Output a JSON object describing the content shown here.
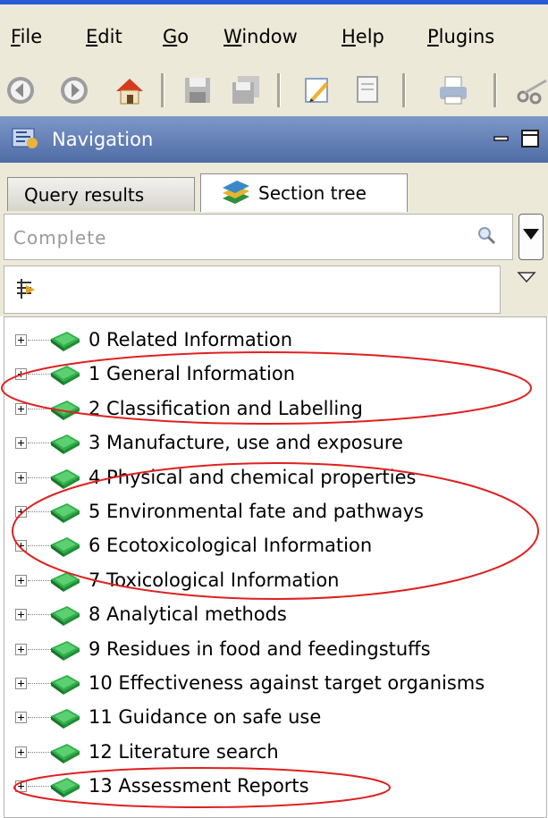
{
  "menu": {
    "items": [
      {
        "u": "F",
        "rest": "ile"
      },
      {
        "u": "E",
        "rest": "dit"
      },
      {
        "u": "G",
        "rest": "o"
      },
      {
        "u": "W",
        "rest": "indow"
      },
      {
        "u": "H",
        "rest": "elp"
      },
      {
        "u": "P",
        "rest": "lugins"
      }
    ]
  },
  "toolbar": {
    "icons": [
      "back-icon",
      "forward-icon",
      "home-icon",
      "save-icon",
      "save-all-icon",
      "edit-icon",
      "document-icon",
      "print-icon",
      "cut-icon"
    ]
  },
  "navigation": {
    "title": "Navigation"
  },
  "tabs": {
    "query_results": "Query results",
    "section_tree": "Section tree"
  },
  "search": {
    "value": "Complete"
  },
  "tree": {
    "items": [
      "0 Related Information",
      "1 General Information",
      "2 Classification and Labelling",
      "3 Manufacture, use and exposure",
      "4 Physical and chemical properties",
      "5 Environmental fate and pathways",
      "6 Ecotoxicological Information",
      "7 Toxicological Information",
      "8 Analytical methods",
      "9 Residues in food and feedingstuffs",
      "10 Effectiveness against target organisms",
      "11 Guidance on safe use",
      "12 Literature search",
      "13 Assessment Reports"
    ]
  },
  "colors": {
    "annotation": "#e02020",
    "book_green": "#1f9a3a",
    "nav_bar": "#5b79b0"
  }
}
